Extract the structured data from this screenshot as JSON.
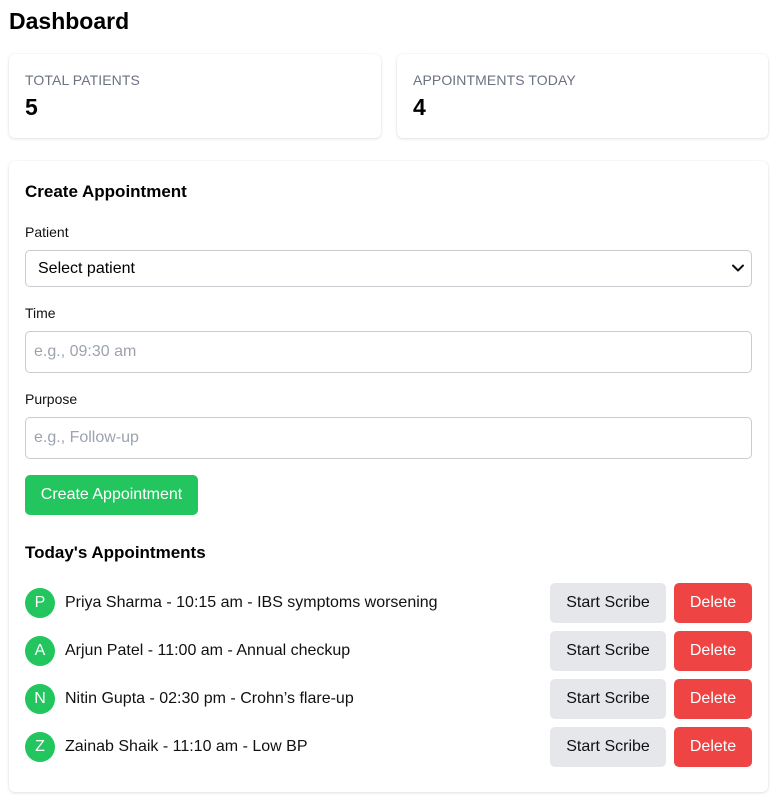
{
  "header": {
    "title": "Dashboard"
  },
  "stats": [
    {
      "label": "TOTAL PATIENTS",
      "value": "5"
    },
    {
      "label": "APPOINTMENTS TODAY",
      "value": "4"
    }
  ],
  "create_form": {
    "title": "Create Appointment",
    "patient_label": "Patient",
    "patient_selected": "Select patient",
    "time_label": "Time",
    "time_placeholder": "e.g., 09:30 am",
    "purpose_label": "Purpose",
    "purpose_placeholder": "e.g., Follow-up",
    "submit_label": "Create Appointment"
  },
  "appointments": {
    "title": "Today's Appointments",
    "start_label": "Start Scribe",
    "delete_label": "Delete",
    "items": [
      {
        "initial": "P",
        "text": "Priya Sharma - 10:15 am - IBS symptoms worsening"
      },
      {
        "initial": "A",
        "text": "Arjun Patel - 11:00 am - Annual checkup"
      },
      {
        "initial": "N",
        "text": "Nitin Gupta - 02:30 pm - Crohn’s flare-up"
      },
      {
        "initial": "Z",
        "text": "Zainab Shaik - 11:10 am - Low BP"
      }
    ]
  },
  "colors": {
    "accent": "#22c55e",
    "danger": "#ef4444",
    "secondary": "#e5e7eb"
  }
}
